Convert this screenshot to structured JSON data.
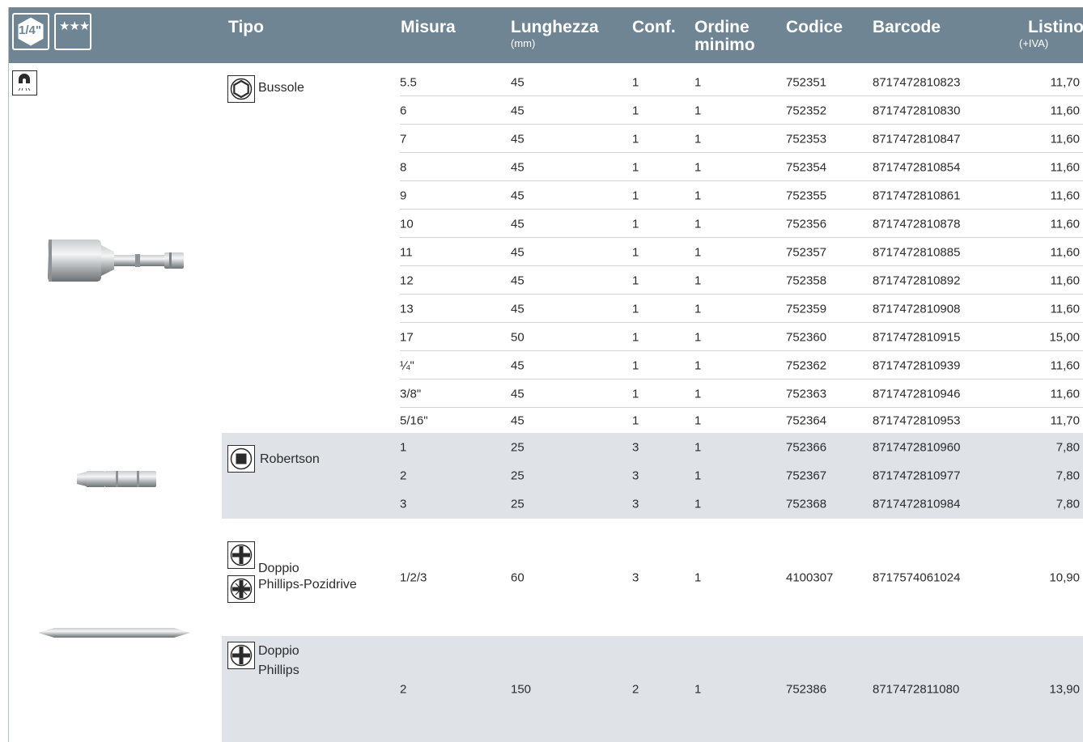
{
  "header": {
    "badge_size": "1/4\"",
    "badge_stars": "★★★",
    "columns": {
      "tipo": "Tipo",
      "misura": "Misura",
      "lunghezza": "Lunghezza",
      "lunghezza_unit": "(mm)",
      "conf": "Conf.",
      "ordine": "Ordine",
      "ordine2": "minimo",
      "codice": "Codice",
      "barcode": "Barcode",
      "listino": "Listino",
      "listino_unit": "(+IVA)"
    }
  },
  "groups": [
    {
      "tipo_label": "Bussole",
      "icon": "hexagon-icon"
    },
    {
      "tipo_label": "Robertson",
      "icon": "square-drive-icon"
    },
    {
      "tipo_label_1": "Doppio",
      "tipo_label_2": "Phillips-Pozidrive",
      "icon": "phillips-icon"
    },
    {
      "tipo_label_1": "Doppio",
      "tipo_label_2": "Phillips",
      "icon": "phillips-icon"
    }
  ],
  "rows": [
    {
      "misura": "5.5",
      "lunghezza": "45",
      "conf": "1",
      "ordine": "1",
      "codice": "752351",
      "barcode": "8717472810823",
      "listino": "11,70"
    },
    {
      "misura": "6",
      "lunghezza": "45",
      "conf": "1",
      "ordine": "1",
      "codice": "752352",
      "barcode": "8717472810830",
      "listino": "11,60"
    },
    {
      "misura": "7",
      "lunghezza": "45",
      "conf": "1",
      "ordine": "1",
      "codice": "752353",
      "barcode": "8717472810847",
      "listino": "11,60"
    },
    {
      "misura": "8",
      "lunghezza": "45",
      "conf": "1",
      "ordine": "1",
      "codice": "752354",
      "barcode": "8717472810854",
      "listino": "11,60"
    },
    {
      "misura": "9",
      "lunghezza": "45",
      "conf": "1",
      "ordine": "1",
      "codice": "752355",
      "barcode": "8717472810861",
      "listino": "11,60"
    },
    {
      "misura": "10",
      "lunghezza": "45",
      "conf": "1",
      "ordine": "1",
      "codice": "752356",
      "barcode": "8717472810878",
      "listino": "11,60"
    },
    {
      "misura": "11",
      "lunghezza": "45",
      "conf": "1",
      "ordine": "1",
      "codice": "752357",
      "barcode": "8717472810885",
      "listino": "11,60"
    },
    {
      "misura": "12",
      "lunghezza": "45",
      "conf": "1",
      "ordine": "1",
      "codice": "752358",
      "barcode": "8717472810892",
      "listino": "11,60"
    },
    {
      "misura": "13",
      "lunghezza": "45",
      "conf": "1",
      "ordine": "1",
      "codice": "752359",
      "barcode": "8717472810908",
      "listino": "11,60"
    },
    {
      "misura": "17",
      "lunghezza": "50",
      "conf": "1",
      "ordine": "1",
      "codice": "752360",
      "barcode": "8717472810915",
      "listino": "15,00"
    },
    {
      "misura": "¼\"",
      "lunghezza": "45",
      "conf": "1",
      "ordine": "1",
      "codice": "752362",
      "barcode": "8717472810939",
      "listino": "11,60"
    },
    {
      "misura": "3/8\"",
      "lunghezza": "45",
      "conf": "1",
      "ordine": "1",
      "codice": "752363",
      "barcode": "8717472810946",
      "listino": "11,60"
    },
    {
      "misura": "5/16\"",
      "lunghezza": "45",
      "conf": "1",
      "ordine": "1",
      "codice": "752364",
      "barcode": "8717472810953",
      "listino": "11,70"
    },
    {
      "misura": "1",
      "lunghezza": "25",
      "conf": "3",
      "ordine": "1",
      "codice": "752366",
      "barcode": "8717472810960",
      "listino": "7,80"
    },
    {
      "misura": "2",
      "lunghezza": "25",
      "conf": "3",
      "ordine": "1",
      "codice": "752367",
      "barcode": "8717472810977",
      "listino": "7,80"
    },
    {
      "misura": "3",
      "lunghezza": "25",
      "conf": "3",
      "ordine": "1",
      "codice": "752368",
      "barcode": "8717472810984",
      "listino": "7,80"
    },
    {
      "misura": "1/2/3",
      "lunghezza": "60",
      "conf": "3",
      "ordine": "1",
      "codice": "4100307",
      "barcode": "8717574061024",
      "listino": "10,90"
    },
    {
      "misura": "2",
      "lunghezza": "150",
      "conf": "2",
      "ordine": "1",
      "codice": "752386",
      "barcode": "8717472811080",
      "listino": "13,90"
    }
  ],
  "colors": {
    "header_bg": "#6f8593",
    "shaded_bg": "#dfe3e8",
    "rule": "#d3d6d9"
  }
}
